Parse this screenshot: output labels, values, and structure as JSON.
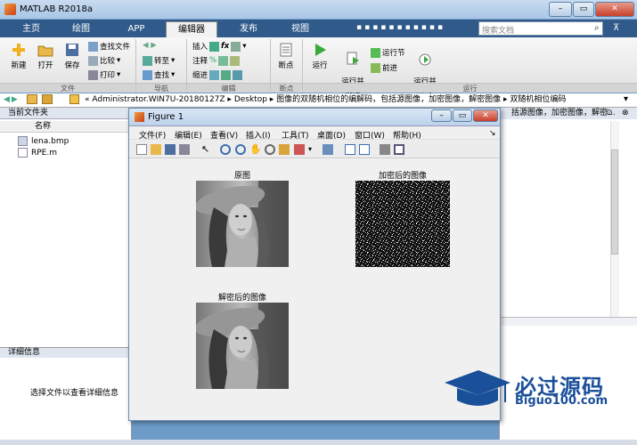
{
  "app": {
    "title": "MATLAB R2018a"
  },
  "tabs": [
    {
      "label": "主页"
    },
    {
      "label": "绘图"
    },
    {
      "label": "APP"
    },
    {
      "label": "编辑器"
    },
    {
      "label": "发布"
    },
    {
      "label": "视图"
    }
  ],
  "search": {
    "placeholder": "搜索文档"
  },
  "ribbon": {
    "new": "新建",
    "open": "打开",
    "save": "保存",
    "find_files": "查找文件",
    "compare": "比较",
    "print": "打印",
    "goto": "转至",
    "find": "查找",
    "insert": "插入",
    "comment": "注释",
    "indent": "缩进",
    "breakpoint": "断点",
    "run": "运行",
    "run_advance": "运行并\n前进",
    "run_section": "运行节",
    "advance": "前进",
    "run_time": "运行并\n计时",
    "groups": {
      "file": "文件",
      "nav": "导航",
      "edit": "编辑",
      "bp": "断点",
      "run": "运行"
    }
  },
  "address": {
    "path": "« Administrator.WIN7U-20180127Z ▸ Desktop ▸ 图像的双随机相位的编解码，包括源图像，加密图像，解密图像 ▸ 双随机相位编码"
  },
  "left_panel": {
    "title": "当前文件夹",
    "column": "名称",
    "files": [
      "lena.bmp",
      "RPE.m"
    ],
    "detail_title": "详细信息",
    "detail_text": "选择文件以查看详细信息"
  },
  "right_panel": {
    "title": "括源图像，加密图像，解密..."
  },
  "figure": {
    "title": "Figure 1",
    "menus": [
      "文件(F)",
      "编辑(E)",
      "查看(V)",
      "插入(I)",
      "工具(T)",
      "桌面(D)",
      "窗口(W)",
      "帮助(H)"
    ],
    "plots": [
      {
        "title": "原图"
      },
      {
        "title": "加密后的图像"
      },
      {
        "title": "解密后的图像"
      }
    ]
  },
  "watermark": {
    "text": "必过源码",
    "sub": "Biguo100.com"
  },
  "colors": {
    "accent": "#2f5a8a",
    "watermark": "#1a4f9a"
  }
}
